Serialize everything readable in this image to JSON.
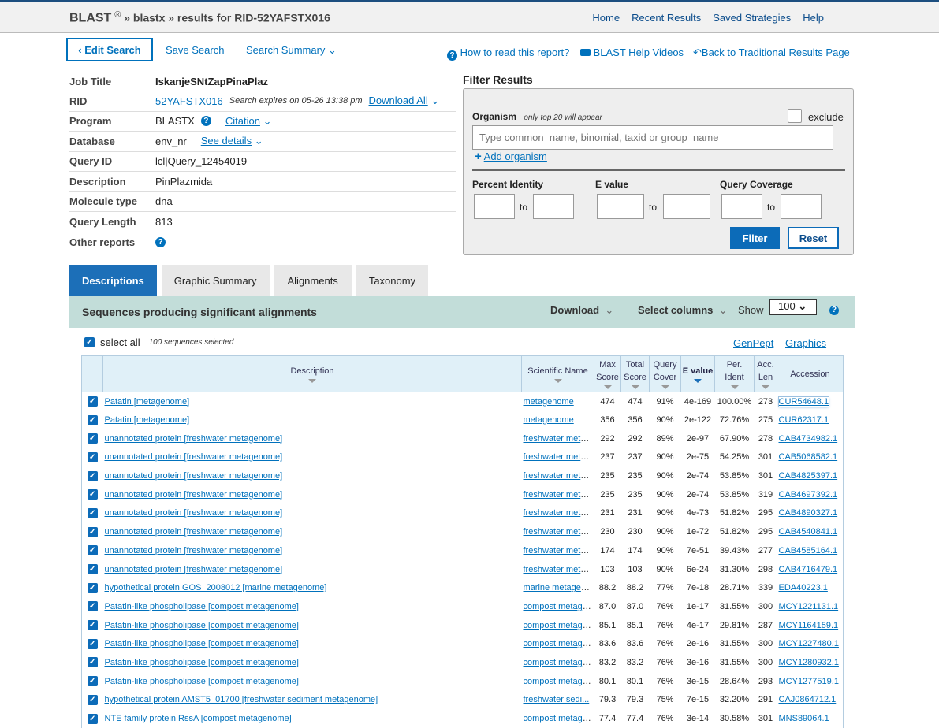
{
  "header": {
    "brand": "BLAST",
    "reg": "®",
    "crumb_rest": " » blastx » results for RID-52YAFSTX016",
    "nav": [
      "Home",
      "Recent Results",
      "Saved Strategies",
      "Help"
    ]
  },
  "toolbar": {
    "edit": "Edit Search",
    "save": "Save Search",
    "summary": "Search Summary",
    "how": "How to read this report?",
    "videos": "BLAST Help Videos",
    "back": "Back to Traditional Results Page"
  },
  "info": {
    "job_title_k": "Job Title",
    "job_title": "IskanjeSNtZapPinaPlaz",
    "rid_k": "RID",
    "rid": "52YAFSTX016",
    "expires": "Search expires on 05-26 13:38 pm",
    "download_all": "Download All",
    "program_k": "Program",
    "program": "BLASTX",
    "citation": "Citation",
    "database_k": "Database",
    "database": "env_nr",
    "see_details": "See details",
    "query_id_k": "Query ID",
    "query_id": "lcl|Query_12454019",
    "description_k": "Description",
    "description": "PinPlazmida",
    "molecule_k": "Molecule type",
    "molecule": "dna",
    "qlen_k": "Query Length",
    "qlen": "813",
    "other_k": "Other reports"
  },
  "filter": {
    "title": "Filter Results",
    "organism": "Organism",
    "org_note": "only top 20 will appear",
    "exclude": "exclude",
    "org_placeholder": "Type common  name, binomial, taxid or group  name",
    "add_org": "Add organism",
    "pct": "Percent Identity",
    "evalue": "E value",
    "qcov": "Query Coverage",
    "to": "to",
    "filter_btn": "Filter",
    "reset_btn": "Reset"
  },
  "tabs": [
    "Descriptions",
    "Graphic Summary",
    "Alignments",
    "Taxonomy"
  ],
  "results": {
    "title": "Sequences producing significant alignments",
    "download": "Download",
    "select_columns": "Select columns",
    "show": "Show",
    "show_value": "100",
    "select_all": "select all",
    "selected": "100 sequences selected",
    "genpept": "GenPept",
    "graphics": "Graphics",
    "columns": [
      "Description",
      "Scientific Name",
      "Max Score",
      "Total Score",
      "Query Cover",
      "E value",
      "Per. Ident",
      "Acc. Len",
      "Accession"
    ],
    "rows": [
      [
        "Patatin [metagenome]",
        "metagenome",
        "474",
        "474",
        "91%",
        "4e-169",
        "100.00%",
        "273",
        "CUR54648.1"
      ],
      [
        "Patatin [metagenome]",
        "metagenome",
        "356",
        "356",
        "90%",
        "2e-122",
        "72.76%",
        "275",
        "CUR62317.1"
      ],
      [
        "unannotated protein [freshwater metagenome]",
        "freshwater meta...",
        "292",
        "292",
        "89%",
        "2e-97",
        "67.90%",
        "278",
        "CAB4734982.1"
      ],
      [
        "unannotated protein [freshwater metagenome]",
        "freshwater meta...",
        "237",
        "237",
        "90%",
        "2e-75",
        "54.25%",
        "301",
        "CAB5068582.1"
      ],
      [
        "unannotated protein [freshwater metagenome]",
        "freshwater meta...",
        "235",
        "235",
        "90%",
        "2e-74",
        "53.85%",
        "301",
        "CAB4825397.1"
      ],
      [
        "unannotated protein [freshwater metagenome]",
        "freshwater meta...",
        "235",
        "235",
        "90%",
        "2e-74",
        "53.85%",
        "319",
        "CAB4697392.1"
      ],
      [
        "unannotated protein [freshwater metagenome]",
        "freshwater meta...",
        "231",
        "231",
        "90%",
        "4e-73",
        "51.82%",
        "295",
        "CAB4890327.1"
      ],
      [
        "unannotated protein [freshwater metagenome]",
        "freshwater meta...",
        "230",
        "230",
        "90%",
        "1e-72",
        "51.82%",
        "295",
        "CAB4540841.1"
      ],
      [
        "unannotated protein [freshwater metagenome]",
        "freshwater meta...",
        "174",
        "174",
        "90%",
        "7e-51",
        "39.43%",
        "277",
        "CAB4585164.1"
      ],
      [
        "unannotated protein [freshwater metagenome]",
        "freshwater meta...",
        "103",
        "103",
        "90%",
        "6e-24",
        "31.30%",
        "298",
        "CAB4716479.1"
      ],
      [
        "hypothetical protein GOS_2008012 [marine metagenome]",
        "marine metagen...",
        "88.2",
        "88.2",
        "77%",
        "7e-18",
        "28.71%",
        "339",
        "EDA40223.1"
      ],
      [
        "Patatin-like phospholipase [compost metagenome]",
        "compost metage...",
        "87.0",
        "87.0",
        "76%",
        "1e-17",
        "31.55%",
        "300",
        "MCY1221131.1"
      ],
      [
        "Patatin-like phospholipase [compost metagenome]",
        "compost metage...",
        "85.1",
        "85.1",
        "76%",
        "4e-17",
        "29.81%",
        "287",
        "MCY1164159.1"
      ],
      [
        "Patatin-like phospholipase [compost metagenome]",
        "compost metage...",
        "83.6",
        "83.6",
        "76%",
        "2e-16",
        "31.55%",
        "300",
        "MCY1227480.1"
      ],
      [
        "Patatin-like phospholipase [compost metagenome]",
        "compost metage...",
        "83.2",
        "83.2",
        "76%",
        "3e-16",
        "31.55%",
        "300",
        "MCY1280932.1"
      ],
      [
        "Patatin-like phospholipase [compost metagenome]",
        "compost metage...",
        "80.1",
        "80.1",
        "76%",
        "3e-15",
        "28.64%",
        "293",
        "MCY1277519.1"
      ],
      [
        "hypothetical protein AMST5_01700 [freshwater sediment metagenome]",
        "freshwater sedi...",
        "79.3",
        "79.3",
        "75%",
        "7e-15",
        "32.20%",
        "291",
        "CAJ0864712.1"
      ],
      [
        "NTE family protein RssA [compost metagenome]",
        "compost metage...",
        "77.4",
        "77.4",
        "76%",
        "3e-14",
        "30.58%",
        "301",
        "MNS89064.1"
      ]
    ]
  }
}
